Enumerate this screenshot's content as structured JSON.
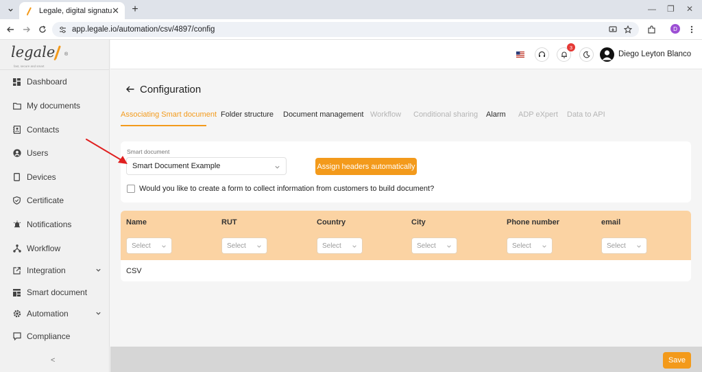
{
  "browser": {
    "tab_title": "Legale, digital signature",
    "url": "app.legale.io/automation/csv/4897/config",
    "profile_initial": "D",
    "new_tab": "+"
  },
  "logo": {
    "word": "legale",
    "tagline": "fast, secure and smart"
  },
  "sidebar": {
    "items": [
      {
        "label": "Dashboard",
        "icon": "dashboard-icon"
      },
      {
        "label": "My documents",
        "icon": "folder-icon"
      },
      {
        "label": "Contacts",
        "icon": "contacts-icon"
      },
      {
        "label": "Users",
        "icon": "user-icon"
      },
      {
        "label": "Devices",
        "icon": "device-icon"
      },
      {
        "label": "Certificate",
        "icon": "shield-icon"
      },
      {
        "label": "Notifications",
        "icon": "bell-icon"
      },
      {
        "label": "Workflow",
        "icon": "workflow-icon"
      },
      {
        "label": "Integration",
        "icon": "external-link-icon",
        "expandable": true
      },
      {
        "label": "Smart document",
        "icon": "smart-doc-icon"
      },
      {
        "label": "Automation",
        "icon": "gear-icon",
        "expandable": true
      },
      {
        "label": "Compliance",
        "icon": "chat-icon"
      }
    ],
    "collapse_label": "<"
  },
  "header": {
    "notification_count": "3",
    "user_name": "Diego Leyton Blanco"
  },
  "page": {
    "title": "Configuration",
    "tabs": [
      {
        "label": "Associating Smart document",
        "state": "active"
      },
      {
        "label": "Folder structure",
        "state": "normal"
      },
      {
        "label": "Document management",
        "state": "normal"
      },
      {
        "label": "Workflow",
        "state": "disabled"
      },
      {
        "label": "Conditional sharing",
        "state": "disabled"
      },
      {
        "label": "Alarm",
        "state": "normal"
      },
      {
        "label": "ADP eXpert",
        "state": "disabled"
      },
      {
        "label": "Data to API",
        "state": "disabled"
      }
    ],
    "smart_document": {
      "label": "Smart document",
      "value": "Smart Document Example",
      "assign_button": "Assign headers automatically",
      "form_question": "Would you like to create a form to collect information from customers to build document?"
    },
    "mapping": {
      "columns": [
        {
          "name": "Name",
          "select": "Select"
        },
        {
          "name": "RUT",
          "select": "Select"
        },
        {
          "name": "Country",
          "select": "Select"
        },
        {
          "name": "City",
          "select": "Select"
        },
        {
          "name": "Phone number",
          "select": "Select"
        },
        {
          "name": "email",
          "select": "Select"
        }
      ],
      "row_label": "CSV"
    },
    "save_button": "Save"
  },
  "colors": {
    "accent": "#f39a1b",
    "header_row": "#fbd3a3",
    "annotation_arrow": "#e02020"
  }
}
